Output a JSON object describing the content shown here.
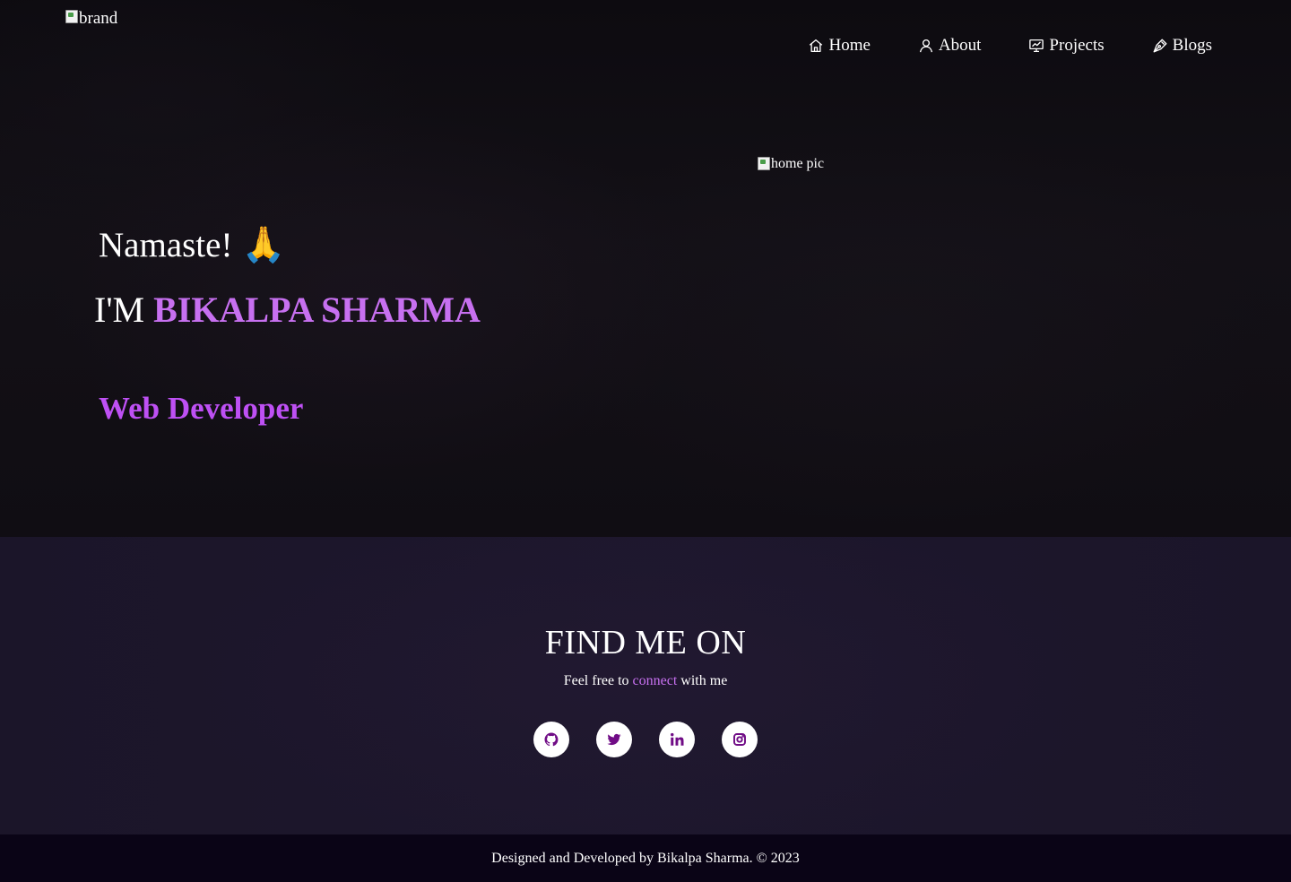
{
  "navbar": {
    "brand_alt": "brand",
    "items": [
      {
        "label": "Home",
        "icon": "home-icon"
      },
      {
        "label": "About",
        "icon": "user-icon"
      },
      {
        "label": "Projects",
        "icon": "projects-icon"
      },
      {
        "label": "Blogs",
        "icon": "pen-icon"
      }
    ]
  },
  "hero": {
    "greeting": "Namaste!",
    "greeting_emoji": "🙏",
    "intro_prefix": "I'M",
    "name": "BIKALPA SHARMA",
    "role": "Web Developer",
    "image_alt": "home pic"
  },
  "social": {
    "title": "FIND ME ON",
    "subtitle_before": "Feel free to",
    "subtitle_accent": "connect",
    "subtitle_after": "with me",
    "links": [
      {
        "icon": "github-icon"
      },
      {
        "icon": "twitter-icon"
      },
      {
        "icon": "linkedin-icon"
      },
      {
        "icon": "instagram-icon"
      }
    ]
  },
  "footer": {
    "text": "Designed and Developed by Bikalpa Sharma. © 2023"
  },
  "colors": {
    "accent": "#c770f0",
    "role": "#be50f4",
    "icon": "#700c86",
    "hero_bg": "#0c0a0f",
    "section_bg": "#1b1529",
    "footer_bg": "#0a0416"
  }
}
